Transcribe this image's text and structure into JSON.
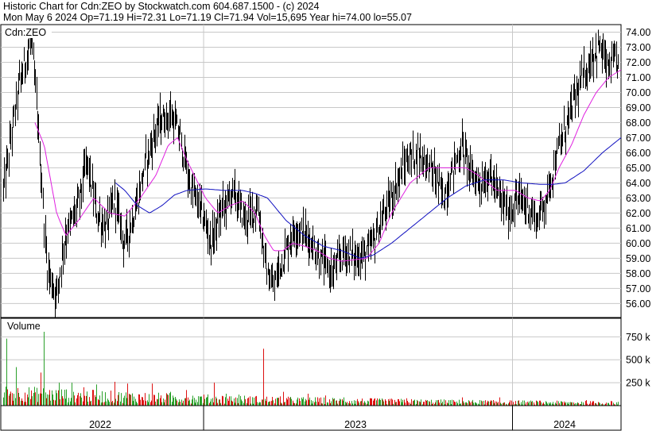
{
  "header": {
    "line1": "Historic Chart for Cdn:ZEO by Stockwatch.com 604.687.1500 - (c) 2024",
    "line2": "Mon May  6 2024   Op=71.19   Hi=72.31   Lo=71.19   Cl=71.94   Vol=15,695   Year hi=74.00   lo=55.07"
  },
  "colors": {
    "price_bar": "#000000",
    "ma_short": "#e020e0",
    "ma_long": "#1010c0",
    "vol_up": "#2aa02a",
    "vol_down": "#dd1111",
    "grid": "#c8c8c8",
    "frame": "#000000"
  },
  "chart_data": [
    {
      "type": "line",
      "title": "Cdn:ZEO",
      "ylim": [
        55.07,
        74.5
      ],
      "y_ticks": [
        "74.00",
        "73.00",
        "72.00",
        "71.00",
        "70.00",
        "69.00",
        "68.00",
        "67.00",
        "66.00",
        "65.00",
        "64.00",
        "63.00",
        "62.00",
        "61.00",
        "60.00",
        "59.00",
        "58.00",
        "57.00",
        "56.00"
      ],
      "x_ticks": [
        "2022",
        "2023",
        "2024"
      ],
      "grid": true,
      "price_anchors": [
        [
          0,
          63.5
        ],
        [
          0.025,
          70.5
        ],
        [
          0.045,
          73.5
        ],
        [
          0.055,
          68.5
        ],
        [
          0.07,
          58.5
        ],
        [
          0.085,
          56.5
        ],
        [
          0.1,
          60.5
        ],
        [
          0.12,
          62.5
        ],
        [
          0.135,
          65.5
        ],
        [
          0.15,
          62.0
        ],
        [
          0.165,
          61.0
        ],
        [
          0.18,
          63.0
        ],
        [
          0.195,
          60.0
        ],
        [
          0.215,
          62.5
        ],
        [
          0.23,
          65.5
        ],
        [
          0.25,
          68.0
        ],
        [
          0.27,
          68.5
        ],
        [
          0.285,
          67.0
        ],
        [
          0.3,
          64.0
        ],
        [
          0.32,
          62.0
        ],
        [
          0.335,
          60.0
        ],
        [
          0.35,
          62.0
        ],
        [
          0.37,
          63.5
        ],
        [
          0.39,
          61.5
        ],
        [
          0.41,
          62.5
        ],
        [
          0.425,
          58.0
        ],
        [
          0.435,
          57.0
        ],
        [
          0.45,
          59.0
        ],
        [
          0.47,
          61.0
        ],
        [
          0.49,
          60.5
        ],
        [
          0.51,
          59.0
        ],
        [
          0.53,
          58.0
        ],
        [
          0.55,
          59.5
        ],
        [
          0.57,
          59.0
        ],
        [
          0.59,
          59.5
        ],
        [
          0.61,
          61.5
        ],
        [
          0.63,
          63.5
        ],
        [
          0.65,
          65.5
        ],
        [
          0.67,
          66.0
        ],
        [
          0.69,
          65.0
        ],
        [
          0.71,
          63.0
        ],
        [
          0.725,
          65.0
        ],
        [
          0.74,
          66.5
        ],
        [
          0.755,
          64.5
        ],
        [
          0.77,
          64.0
        ],
        [
          0.785,
          64.5
        ],
        [
          0.8,
          63.0
        ],
        [
          0.815,
          62.0
        ],
        [
          0.83,
          63.0
        ],
        [
          0.845,
          62.5
        ],
        [
          0.86,
          61.5
        ],
        [
          0.875,
          63.0
        ],
        [
          0.89,
          65.5
        ],
        [
          0.905,
          67.5
        ],
        [
          0.92,
          69.5
        ],
        [
          0.935,
          71.0
        ],
        [
          0.95,
          72.5
        ],
        [
          0.962,
          73.0
        ],
        [
          0.975,
          71.5
        ],
        [
          0.985,
          72.0
        ],
        [
          1.0,
          71.94
        ]
      ],
      "ma_short_anchors": [
        [
          0.055,
          68.0
        ],
        [
          0.07,
          66.5
        ],
        [
          0.09,
          62.0
        ],
        [
          0.105,
          60.5
        ],
        [
          0.125,
          61.5
        ],
        [
          0.15,
          63.0
        ],
        [
          0.175,
          62.0
        ],
        [
          0.2,
          61.8
        ],
        [
          0.225,
          63.0
        ],
        [
          0.25,
          64.5
        ],
        [
          0.27,
          66.5
        ],
        [
          0.285,
          67.0
        ],
        [
          0.3,
          65.5
        ],
        [
          0.33,
          63.0
        ],
        [
          0.35,
          62.0
        ],
        [
          0.37,
          62.5
        ],
        [
          0.39,
          62.8
        ],
        [
          0.41,
          62.0
        ],
        [
          0.425,
          60.5
        ],
        [
          0.44,
          59.5
        ],
        [
          0.455,
          59.5
        ],
        [
          0.47,
          60.0
        ],
        [
          0.49,
          59.8
        ],
        [
          0.51,
          59.5
        ],
        [
          0.53,
          59.0
        ],
        [
          0.55,
          58.8
        ],
        [
          0.57,
          58.9
        ],
        [
          0.59,
          59.0
        ],
        [
          0.61,
          60.0
        ],
        [
          0.63,
          62.0
        ],
        [
          0.66,
          64.0
        ],
        [
          0.69,
          65.0
        ],
        [
          0.72,
          65.0
        ],
        [
          0.75,
          65.0
        ],
        [
          0.77,
          64.5
        ],
        [
          0.8,
          63.5
        ],
        [
          0.83,
          63.5
        ],
        [
          0.85,
          63.0
        ],
        [
          0.87,
          62.8
        ],
        [
          0.885,
          63.5
        ],
        [
          0.9,
          65.0
        ],
        [
          0.92,
          66.5
        ],
        [
          0.94,
          68.5
        ],
        [
          0.96,
          70.0
        ],
        [
          0.98,
          71.0
        ],
        [
          1.0,
          71.5
        ]
      ],
      "ma_long_anchors": [
        [
          0.185,
          64.0
        ],
        [
          0.2,
          63.5
        ],
        [
          0.22,
          62.5
        ],
        [
          0.24,
          62.0
        ],
        [
          0.26,
          62.5
        ],
        [
          0.28,
          63.2
        ],
        [
          0.3,
          63.5
        ],
        [
          0.33,
          63.6
        ],
        [
          0.36,
          63.5
        ],
        [
          0.39,
          63.5
        ],
        [
          0.41,
          63.3
        ],
        [
          0.43,
          63.0
        ],
        [
          0.46,
          61.5
        ],
        [
          0.49,
          60.5
        ],
        [
          0.52,
          59.8
        ],
        [
          0.55,
          59.5
        ],
        [
          0.58,
          59.0
        ],
        [
          0.6,
          59.2
        ],
        [
          0.63,
          60.0
        ],
        [
          0.66,
          61.0
        ],
        [
          0.69,
          62.0
        ],
        [
          0.72,
          63.0
        ],
        [
          0.75,
          63.8
        ],
        [
          0.78,
          64.2
        ],
        [
          0.81,
          64.2
        ],
        [
          0.84,
          64.0
        ],
        [
          0.87,
          63.9
        ],
        [
          0.89,
          63.9
        ],
        [
          0.91,
          64.0
        ],
        [
          0.94,
          64.8
        ],
        [
          0.97,
          66.0
        ],
        [
          1.0,
          67.0
        ]
      ]
    },
    {
      "type": "bar",
      "title": "Volume",
      "y_ticks": [
        "750 k",
        "500 k",
        "250 k"
      ],
      "y_tick_values": [
        750000,
        500000,
        250000
      ],
      "ylim": [
        0,
        900000
      ],
      "spike_anchors": [
        [
          0.005,
          730000
        ],
        [
          0.02,
          420000
        ],
        [
          0.06,
          360000
        ],
        [
          0.065,
          860000
        ],
        [
          0.09,
          250000
        ],
        [
          0.11,
          250000
        ],
        [
          0.13,
          200000
        ],
        [
          0.15,
          230000
        ],
        [
          0.18,
          260000
        ],
        [
          0.2,
          240000
        ],
        [
          0.24,
          240000
        ],
        [
          0.27,
          150000
        ],
        [
          0.295,
          170000
        ],
        [
          0.32,
          100000
        ],
        [
          0.34,
          250000
        ],
        [
          0.36,
          130000
        ],
        [
          0.38,
          120000
        ],
        [
          0.42,
          620000
        ],
        [
          0.45,
          150000
        ],
        [
          0.49,
          130000
        ],
        [
          0.52,
          110000
        ],
        [
          0.55,
          90000
        ],
        [
          0.6,
          80000
        ],
        [
          0.65,
          80000
        ],
        [
          0.7,
          60000
        ],
        [
          0.74,
          90000
        ],
        [
          0.8,
          90000
        ],
        [
          0.86,
          50000
        ],
        [
          0.94,
          60000
        ],
        [
          0.98,
          50000
        ]
      ]
    }
  ]
}
